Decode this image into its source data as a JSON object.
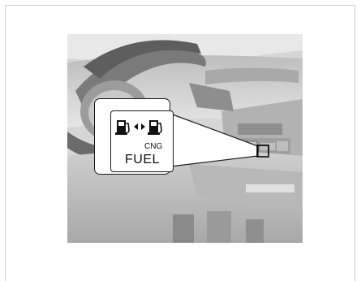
{
  "callout": {
    "label": "FUEL",
    "sublabel": "CNG"
  },
  "icons": {
    "left": "fuel-pump-icon",
    "middle": "double-arrow-icon",
    "right": "fuel-pump-cng-icon"
  }
}
